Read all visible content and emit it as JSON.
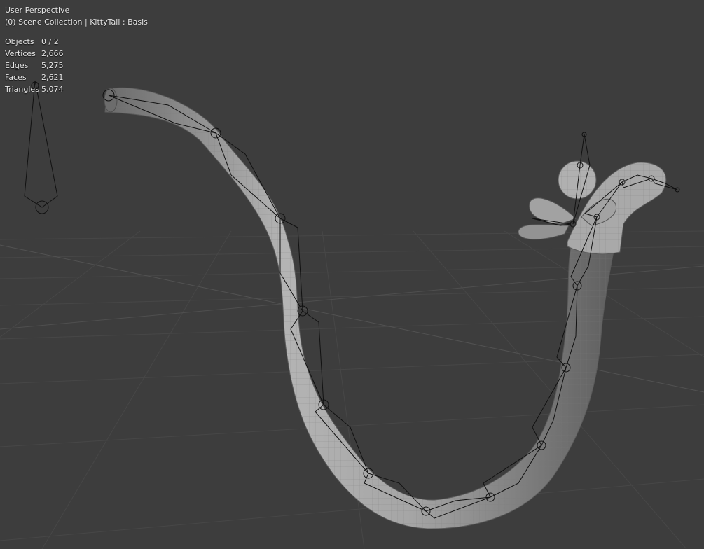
{
  "viewport": {
    "view_name": "User Perspective",
    "context": "(0) Scene Collection | KittyTail : Basis"
  },
  "stats": [
    {
      "label": "Objects",
      "value": "0 / 2"
    },
    {
      "label": "Vertices",
      "value": "2,666"
    },
    {
      "label": "Edges",
      "value": "5,275"
    },
    {
      "label": "Faces",
      "value": "2,621"
    },
    {
      "label": "Triangles",
      "value": "5,074"
    }
  ],
  "colors": {
    "background": "#3d3d3d",
    "grid": "#4a4a4a",
    "mesh": "#9a9a9a",
    "bone_wire": "#111111",
    "text": "#e6e6e6"
  },
  "icons": [
    "armature-bone",
    "joint-circle"
  ]
}
